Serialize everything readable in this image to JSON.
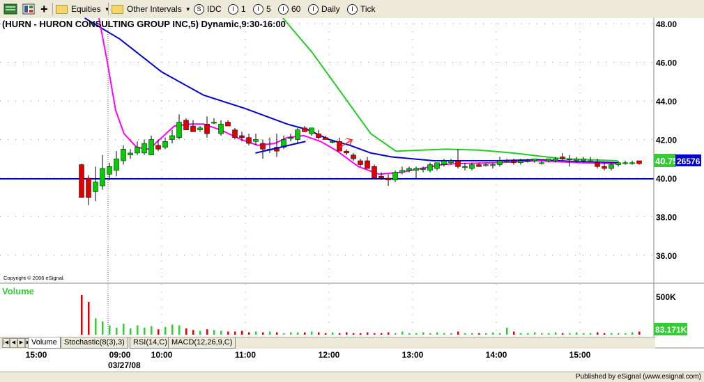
{
  "toolbar": {
    "equities": "Equities",
    "other_intervals": "Other Intervals",
    "idc": "IDC",
    "i1": "1",
    "i5": "5",
    "i60": "60",
    "daily": "Daily",
    "tick": "Tick"
  },
  "chart_data": {
    "type": "candlestick",
    "title": "(HURN - HURON CONSULTING GROUP INC,5) Dynamic,9:30-16:00",
    "copyright": "Copyright © 2006 eSignal.",
    "y_ticks": [
      "48.00",
      "46.00",
      "44.00",
      "42.00",
      "40.00",
      "38.00",
      "36.00"
    ],
    "ylim": [
      35.0,
      48.25
    ],
    "x_ticks": [
      "15:00",
      "09:00",
      "10:00",
      "11:00",
      "12:00",
      "13:00",
      "14:00",
      "15:00"
    ],
    "date_label": "03/27/08",
    "last_price": "40.75",
    "last_volume_readout": "26576",
    "horizontal_line": 39.92,
    "bar_minutes": 5,
    "start_time": "09:30",
    "candles": [
      [
        40.7,
        40.75,
        39.3,
        39.0
      ],
      [
        40.0,
        40.15,
        38.6,
        39.0
      ],
      [
        39.3,
        40.6,
        38.8,
        39.8
      ],
      [
        39.6,
        41.2,
        39.4,
        40.5
      ],
      [
        40.2,
        40.8,
        39.9,
        40.6
      ],
      [
        40.4,
        41.4,
        40.1,
        41.0
      ],
      [
        40.9,
        41.7,
        40.7,
        41.5
      ],
      [
        41.2,
        41.5,
        41.0,
        41.3
      ],
      [
        41.3,
        41.9,
        41.2,
        41.6
      ],
      [
        41.3,
        42.0,
        41.2,
        41.8
      ],
      [
        41.2,
        42.2,
        41.2,
        42.0
      ],
      [
        41.7,
        42.0,
        41.4,
        41.5
      ],
      [
        41.6,
        42.1,
        41.5,
        41.9
      ],
      [
        42.0,
        42.5,
        41.8,
        42.2
      ],
      [
        42.1,
        43.3,
        42.0,
        42.9
      ],
      [
        43.0,
        43.1,
        42.5,
        42.5
      ],
      [
        42.7,
        43.0,
        42.4,
        42.4
      ],
      [
        42.5,
        42.7,
        42.4,
        42.6
      ],
      [
        42.8,
        43.2,
        42.1,
        42.3
      ],
      [
        42.9,
        43.1,
        42.8,
        42.9
      ],
      [
        42.3,
        43.0,
        42.2,
        42.8
      ],
      [
        42.9,
        43.0,
        42.7,
        42.7
      ],
      [
        42.5,
        42.6,
        42.0,
        42.1
      ],
      [
        42.2,
        42.4,
        41.9,
        42.1
      ],
      [
        42.1,
        42.3,
        41.7,
        41.8
      ],
      [
        41.9,
        42.3,
        41.7,
        42.0
      ],
      [
        41.8,
        42.0,
        41.0,
        41.5
      ],
      [
        41.5,
        42.1,
        41.3,
        41.5
      ],
      [
        41.6,
        42.3,
        41.1,
        41.4
      ],
      [
        41.6,
        42.2,
        41.5,
        42.0
      ],
      [
        42.1,
        42.3,
        41.9,
        42.1
      ],
      [
        42.0,
        42.6,
        41.8,
        42.5
      ],
      [
        42.6,
        42.7,
        42.4,
        42.4
      ],
      [
        42.3,
        42.6,
        42.2,
        42.6
      ],
      [
        42.3,
        42.5,
        42.0,
        42.1
      ],
      [
        42.1,
        42.2,
        42.0,
        42.0
      ],
      [
        41.9,
        42.0,
        41.8,
        41.9
      ],
      [
        41.9,
        42.1,
        41.4,
        41.4
      ],
      [
        41.4,
        41.5,
        41.2,
        41.3
      ],
      [
        41.2,
        41.3,
        40.9,
        41.0
      ],
      [
        40.9,
        41.0,
        40.6,
        40.7
      ],
      [
        40.9,
        41.1,
        40.5,
        40.5
      ],
      [
        40.6,
        40.7,
        40.0,
        40.0
      ],
      [
        40.1,
        40.3,
        39.9,
        40.0
      ],
      [
        40.0,
        40.2,
        39.6,
        39.9
      ],
      [
        39.9,
        40.4,
        39.8,
        40.3
      ],
      [
        40.3,
        40.6,
        40.2,
        40.4
      ],
      [
        40.4,
        40.6,
        40.3,
        40.5
      ],
      [
        40.4,
        40.6,
        40.0,
        40.5
      ],
      [
        40.5,
        40.6,
        40.3,
        40.5
      ],
      [
        40.4,
        40.8,
        40.3,
        40.7
      ],
      [
        40.5,
        40.8,
        40.4,
        40.8
      ],
      [
        40.7,
        41.0,
        40.6,
        40.9
      ],
      [
        40.8,
        41.0,
        40.7,
        40.9
      ],
      [
        40.9,
        41.5,
        40.5,
        40.6
      ],
      [
        40.6,
        40.8,
        40.4,
        40.6
      ],
      [
        40.5,
        40.8,
        40.4,
        40.7
      ],
      [
        40.7,
        40.8,
        40.6,
        40.6
      ],
      [
        40.7,
        40.8,
        40.6,
        40.7
      ],
      [
        40.7,
        40.8,
        40.5,
        40.7
      ],
      [
        40.7,
        41.1,
        40.6,
        40.9
      ],
      [
        40.9,
        41.0,
        40.8,
        40.9
      ],
      [
        40.9,
        41.0,
        40.7,
        40.8
      ],
      [
        40.8,
        41.0,
        40.7,
        40.9
      ],
      [
        40.9,
        41.0,
        40.8,
        40.9
      ],
      [
        40.9,
        41.0,
        40.8,
        41.0
      ],
      [
        40.8,
        40.9,
        40.7,
        40.8
      ],
      [
        40.9,
        41.0,
        40.8,
        41.0
      ],
      [
        40.9,
        41.1,
        40.8,
        41.0
      ],
      [
        41.1,
        41.3,
        40.9,
        41.0
      ],
      [
        41.0,
        41.2,
        40.6,
        41.0
      ],
      [
        40.9,
        41.1,
        40.8,
        41.0
      ],
      [
        40.9,
        41.1,
        40.8,
        41.0
      ],
      [
        40.9,
        41.1,
        40.8,
        40.9
      ],
      [
        40.8,
        41.0,
        40.5,
        40.6
      ],
      [
        40.6,
        40.8,
        40.4,
        40.5
      ],
      [
        40.5,
        40.8,
        40.4,
        40.7
      ],
      [
        40.7,
        40.9,
        40.6,
        40.8
      ],
      [
        40.8,
        40.9,
        40.7,
        40.8
      ],
      [
        40.8,
        40.9,
        40.7,
        40.8
      ],
      [
        40.9,
        40.9,
        40.7,
        40.75
      ]
    ],
    "series": [
      {
        "color": "#0000cc",
        "points": [
          [
            9.58,
            48.6
          ],
          [
            10.0,
            47.2
          ],
          [
            10.5,
            45.5
          ],
          [
            11.0,
            44.3
          ],
          [
            11.5,
            43.6
          ],
          [
            12.0,
            42.8
          ],
          [
            12.25,
            42.5
          ],
          [
            12.5,
            42.0
          ],
          [
            12.75,
            41.7
          ],
          [
            13.0,
            41.3
          ],
          [
            13.25,
            41.1
          ],
          [
            13.5,
            41.0
          ],
          [
            13.75,
            40.9
          ],
          [
            14.0,
            40.9
          ],
          [
            14.5,
            40.9
          ],
          [
            15.0,
            40.95
          ],
          [
            15.5,
            40.85
          ],
          [
            15.95,
            40.8
          ]
        ]
      },
      {
        "color": "#ff00ff",
        "points": [
          [
            9.75,
            48.6
          ],
          [
            9.85,
            46.0
          ],
          [
            9.95,
            43.5
          ],
          [
            10.05,
            42.3
          ],
          [
            10.2,
            41.6
          ],
          [
            10.35,
            41.5
          ],
          [
            10.5,
            42.1
          ],
          [
            10.65,
            42.7
          ],
          [
            10.85,
            42.8
          ],
          [
            11.0,
            42.8
          ],
          [
            11.2,
            42.5
          ],
          [
            11.45,
            42.0
          ],
          [
            11.65,
            41.7
          ],
          [
            11.85,
            41.8
          ],
          [
            12.0,
            42.1
          ],
          [
            12.2,
            42.2
          ],
          [
            12.4,
            41.9
          ],
          [
            12.6,
            41.4
          ],
          [
            12.85,
            40.6
          ],
          [
            13.1,
            40.2
          ],
          [
            13.35,
            40.3
          ],
          [
            13.6,
            40.5
          ],
          [
            13.85,
            40.7
          ],
          [
            14.0,
            40.75
          ],
          [
            14.5,
            40.8
          ],
          [
            15.0,
            40.9
          ],
          [
            15.5,
            40.8
          ],
          [
            15.95,
            40.75
          ]
        ]
      },
      {
        "color": "#22cc22",
        "points": [
          [
            11.95,
            48.5
          ],
          [
            12.3,
            46.5
          ],
          [
            12.7,
            44.1
          ],
          [
            13.0,
            42.3
          ],
          [
            13.3,
            41.4
          ],
          [
            13.6,
            41.45
          ],
          [
            13.9,
            41.5
          ],
          [
            14.3,
            41.45
          ],
          [
            14.7,
            41.3
          ],
          [
            15.0,
            41.15
          ],
          [
            15.3,
            41.0
          ],
          [
            15.65,
            40.95
          ],
          [
            15.95,
            40.9
          ]
        ]
      }
    ],
    "trendline": [
      [
        11.62,
        41.3
      ],
      [
        12.22,
        41.9
      ]
    ],
    "volume": {
      "title": "Volume",
      "y_ticks": [
        "500K"
      ],
      "ylim": [
        0,
        500
      ],
      "readout": "83.171K",
      "bars": [
        510,
        420,
        210,
        170,
        120,
        90,
        140,
        80,
        120,
        90,
        110,
        70,
        100,
        130,
        120,
        80,
        60,
        50,
        70,
        60,
        50,
        40,
        40,
        50,
        30,
        40,
        30,
        40,
        30,
        20,
        30,
        30,
        30,
        40,
        30,
        20,
        30,
        20,
        30,
        20,
        20,
        30,
        20,
        20,
        30,
        20,
        40,
        20,
        20,
        30,
        20,
        30,
        20,
        20,
        40,
        20,
        20,
        20,
        20,
        30,
        20,
        90,
        40,
        20,
        20,
        30,
        20,
        20,
        30,
        20,
        20,
        30,
        20,
        20,
        30,
        20,
        20,
        20,
        20,
        30,
        40
      ]
    }
  },
  "tabs": [
    "Volume",
    "Stochastic(8(3),3)",
    "RSI(14,C)",
    "MACD(12,26,9,C)"
  ],
  "status": {
    "published": "Published by eSignal (www.esignal.com)"
  }
}
